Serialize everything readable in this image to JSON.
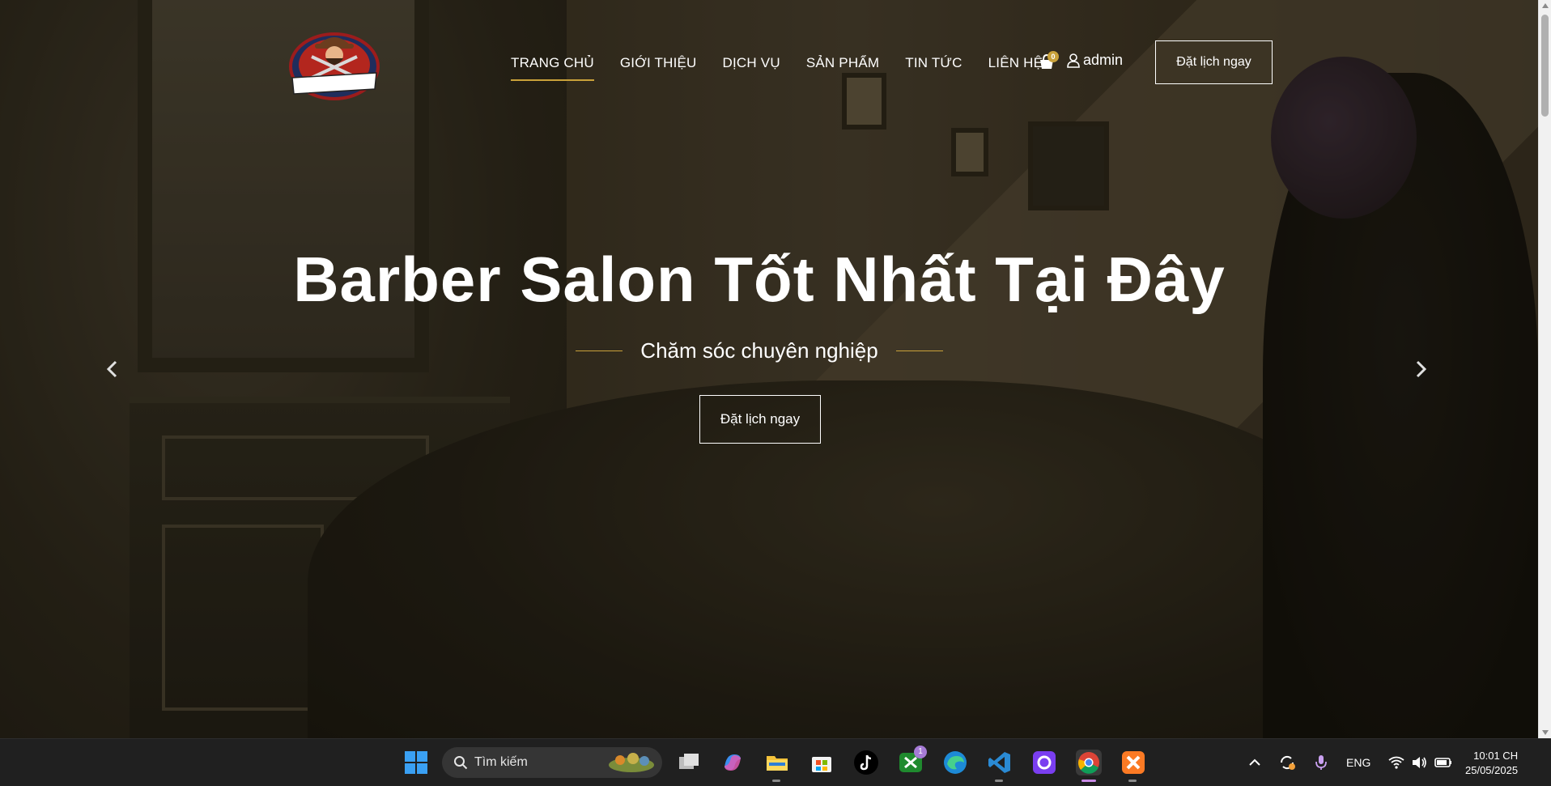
{
  "header": {
    "nav": [
      {
        "label": "TRANG CHỦ",
        "active": true
      },
      {
        "label": "GIỚI THIỆU",
        "active": false
      },
      {
        "label": "DỊCH VỤ",
        "active": false
      },
      {
        "label": "SẢN PHẨM",
        "active": false
      },
      {
        "label": "TIN TỨC",
        "active": false
      },
      {
        "label": "LIÊN HỆ",
        "active": false
      }
    ],
    "cart_count": "0",
    "user_name": "admin",
    "book_button": "Đặt lịch ngay"
  },
  "hero": {
    "title": "Barber Salon Tốt Nhất Tại Đây",
    "subtitle": "Chăm sóc chuyên nghiệp",
    "cta": "Đặt lịch ngay"
  },
  "taskbar": {
    "search_placeholder": "Tìm kiếm",
    "xbox_badge": "1",
    "language": "ENG",
    "time": "10:01 CH",
    "date": "25/05/2025"
  },
  "colors": {
    "accent": "#c9a13a",
    "taskbar": "#202020"
  }
}
